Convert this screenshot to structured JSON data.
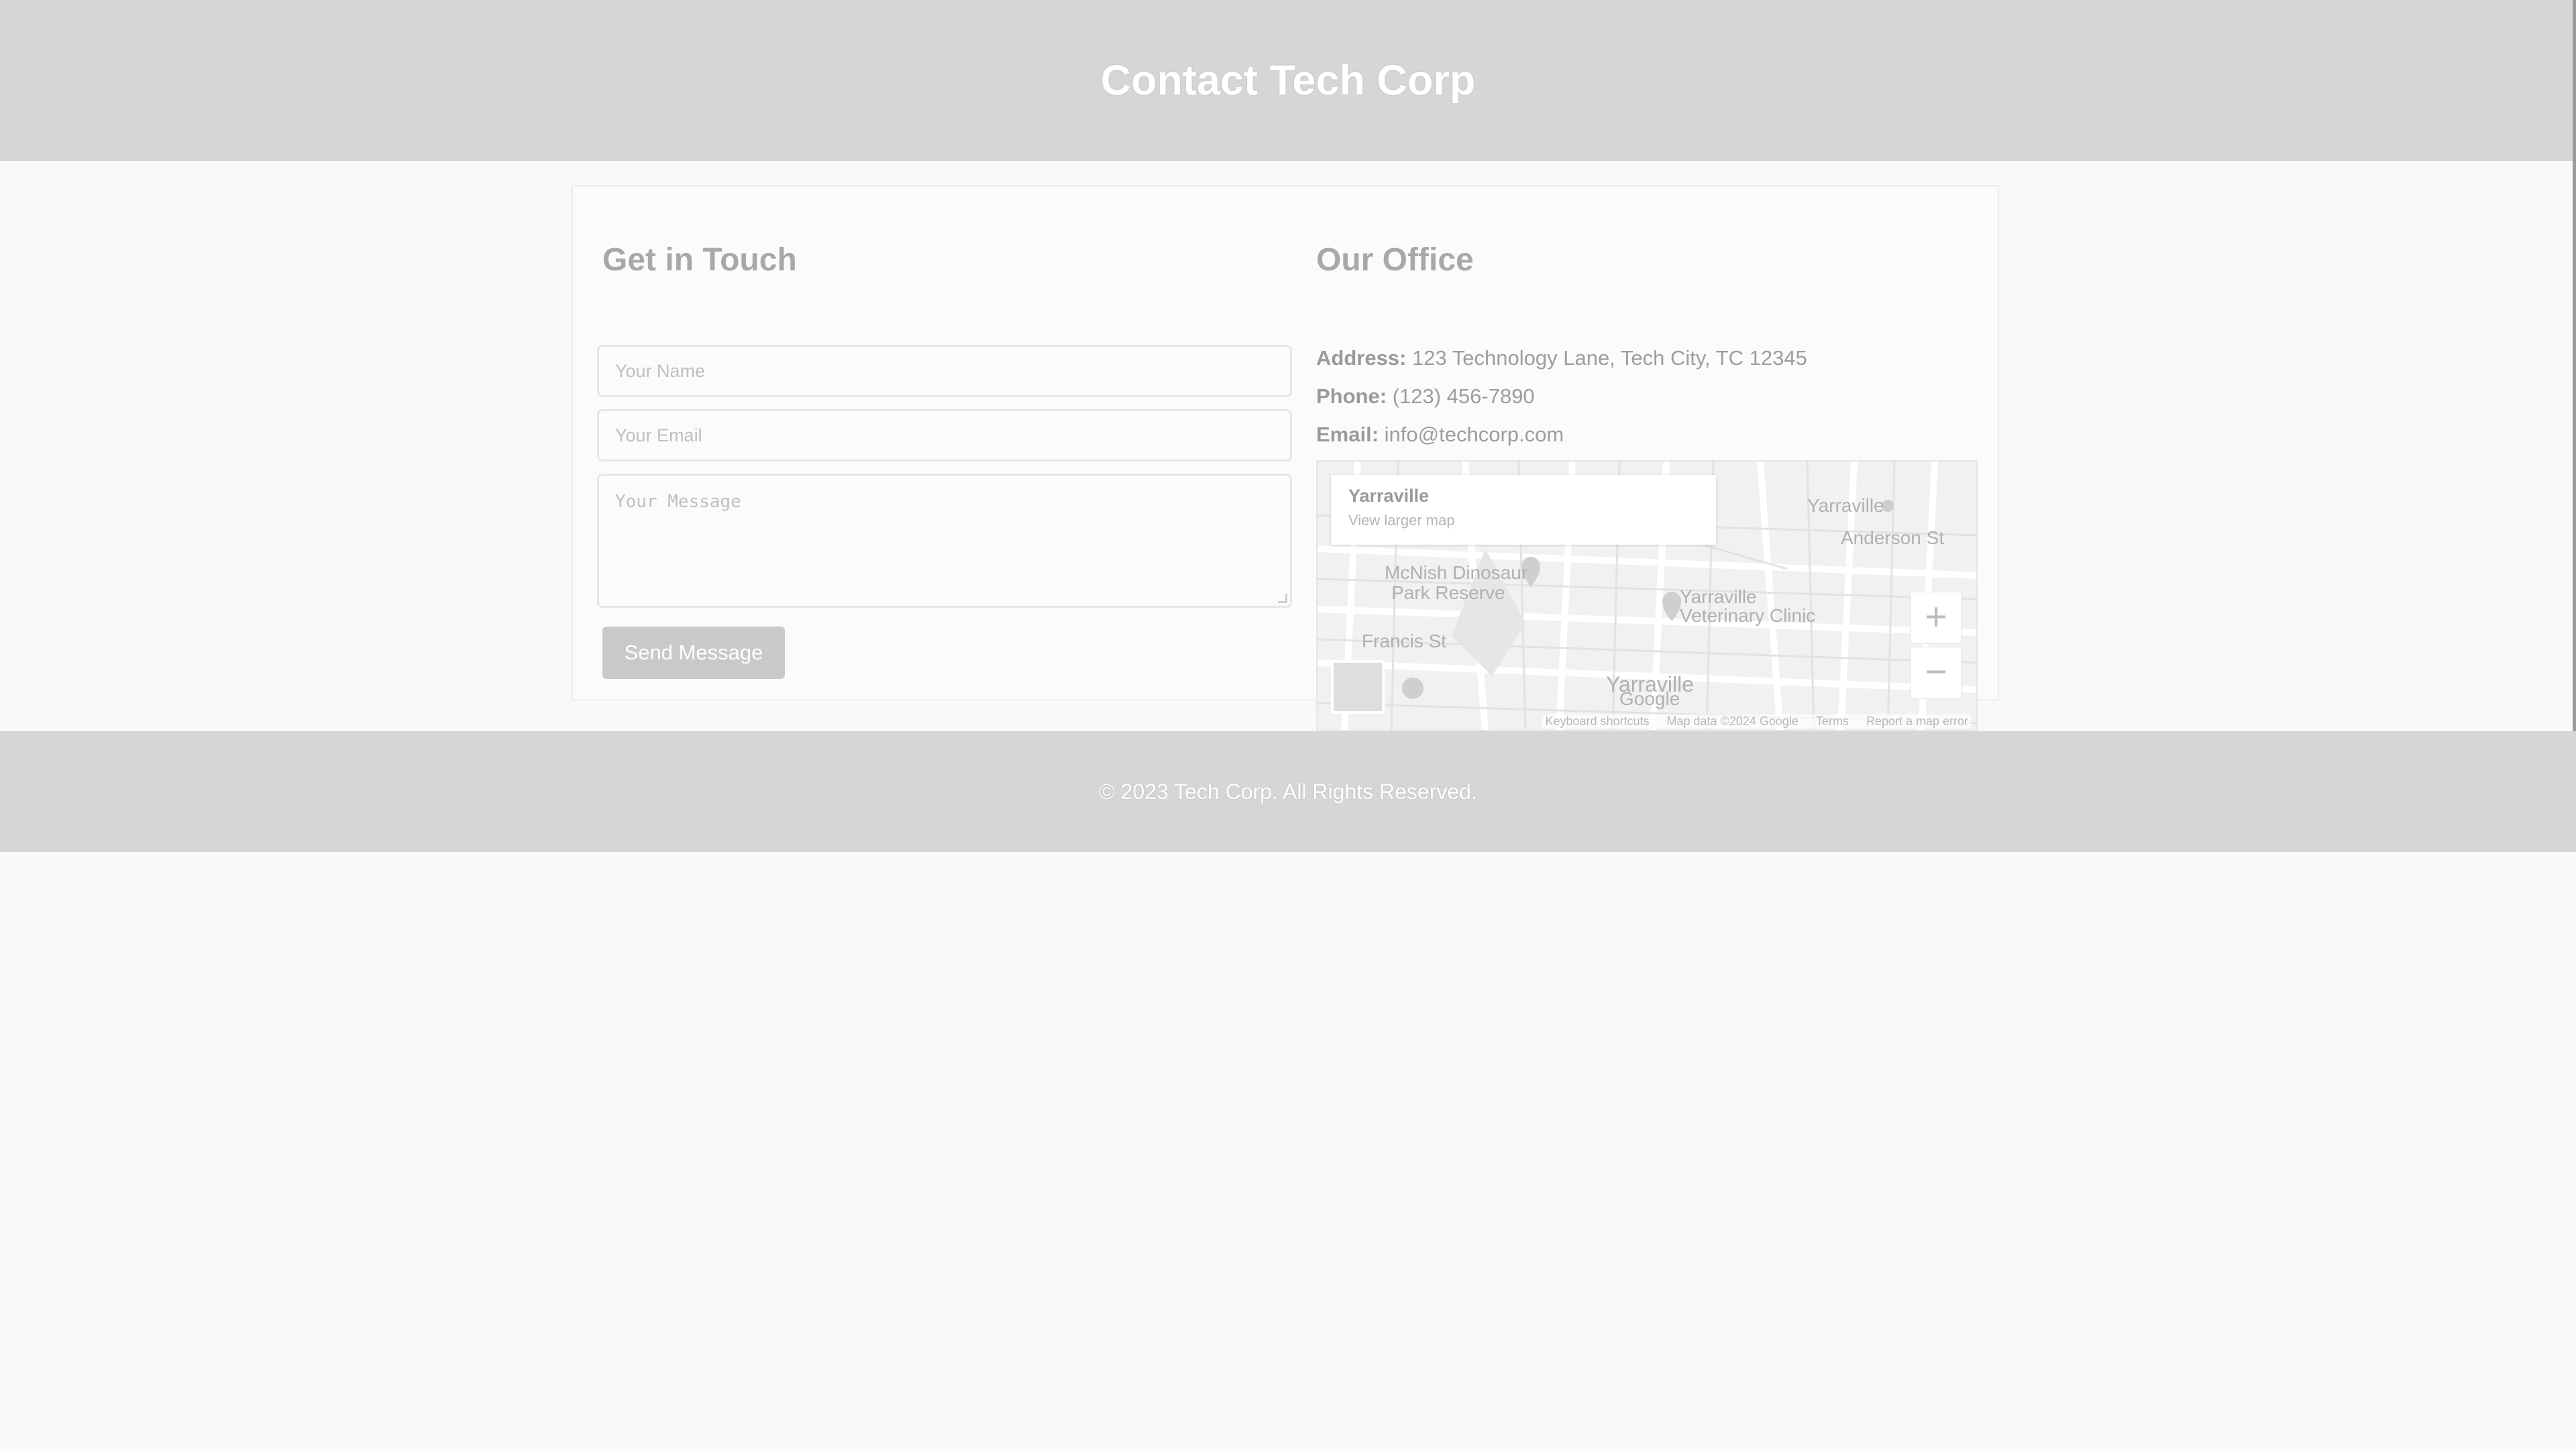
{
  "header": {
    "title": "Contact Tech Corp"
  },
  "contact_form": {
    "title": "Get in Touch",
    "name_placeholder": "Your Name",
    "email_placeholder": "Your Email",
    "message_placeholder": "Your Message",
    "name_value": "",
    "email_value": "",
    "message_value": "",
    "send_label": "Send Message"
  },
  "office": {
    "title": "Our Office",
    "address_label": "Address:",
    "address": "123 Technology Lane, Tech City, TC 12345",
    "phone_label": "Phone:",
    "phone": "(123) 456-7890",
    "email_label": "Email:",
    "email": "info@techcorp.com"
  },
  "map": {
    "place": "Yarraville",
    "view_larger": "View larger map",
    "zoom_in": "+",
    "zoom_out": "−",
    "labels": {
      "park": "Park",
      "dinosaur_park": "McNish Dinosaur",
      "park_reserve": "Park Reserve",
      "yarraville_pin": "Yarraville",
      "anderson_st": "Anderson St",
      "vet_clinic_1": "Yarraville",
      "vet_clinic_2": "Veterinary Clinic",
      "francis_st": "Francis St",
      "suburb": "Yarraville",
      "google": "Google"
    },
    "footer": {
      "shortcuts": "Keyboard shortcuts",
      "data": "Map data ©2024 Google",
      "terms": "Terms",
      "report": "Report a map error"
    }
  },
  "footer": {
    "copyright": "© 2023 Tech Corp. All Rights Reserved."
  }
}
